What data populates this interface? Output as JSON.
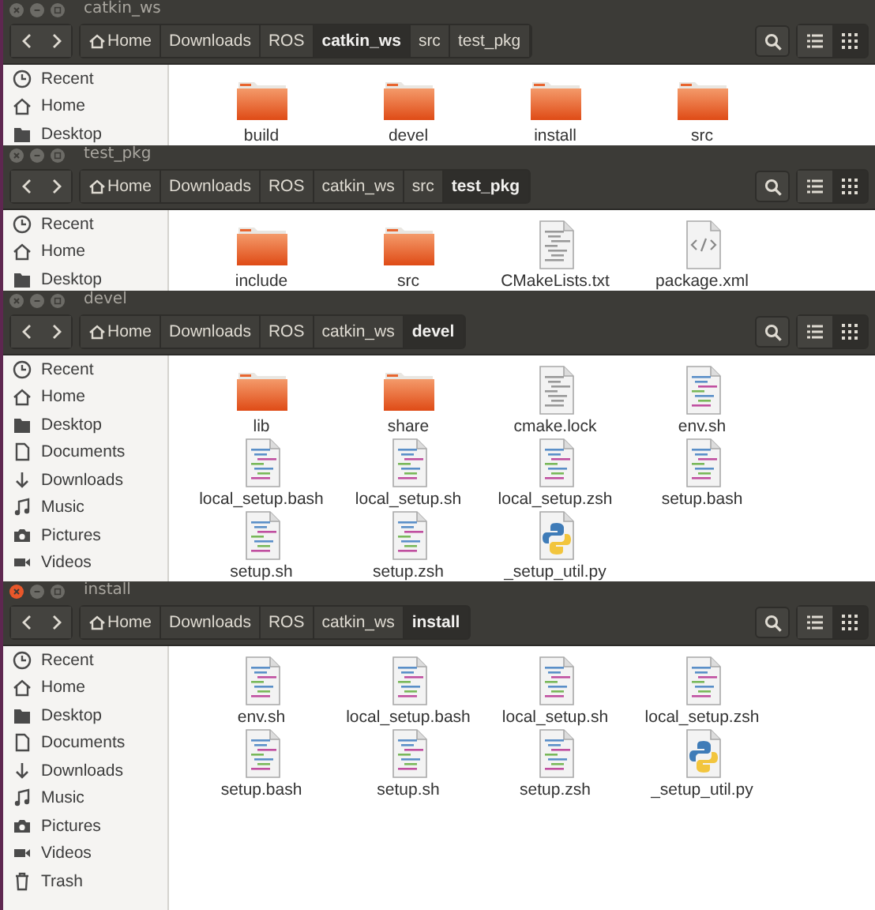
{
  "windows": [
    {
      "title": "catkin_ws",
      "focused": false,
      "path": [
        {
          "label": "Home",
          "kind": "home",
          "selected": false
        },
        {
          "label": "Downloads",
          "kind": "dir",
          "selected": false
        },
        {
          "label": "ROS",
          "kind": "dir",
          "selected": false
        },
        {
          "label": "catkin_ws",
          "kind": "dir",
          "selected": true
        },
        {
          "label": "src",
          "kind": "dir",
          "selected": false
        },
        {
          "label": "test_pkg",
          "kind": "dir",
          "selected": false
        }
      ],
      "views": [
        {
          "kind": "list",
          "selected": false
        },
        {
          "kind": "grid",
          "selected": true
        }
      ],
      "sidebar": [
        {
          "label": "Recent",
          "kind": "recent"
        },
        {
          "label": "Home",
          "kind": "home"
        },
        {
          "label": "Desktop",
          "kind": "desktop"
        }
      ],
      "files": [
        {
          "name": "build",
          "kind": "folder"
        },
        {
          "name": "devel",
          "kind": "folder"
        },
        {
          "name": "install",
          "kind": "folder"
        },
        {
          "name": "src",
          "kind": "folder"
        }
      ]
    },
    {
      "title": "test_pkg",
      "focused": false,
      "path": [
        {
          "label": "Home",
          "kind": "home",
          "selected": false
        },
        {
          "label": "Downloads",
          "kind": "dir",
          "selected": false
        },
        {
          "label": "ROS",
          "kind": "dir",
          "selected": false
        },
        {
          "label": "catkin_ws",
          "kind": "dir",
          "selected": false
        },
        {
          "label": "src",
          "kind": "dir",
          "selected": false
        },
        {
          "label": "test_pkg",
          "kind": "dir",
          "selected": true
        }
      ],
      "views": [
        {
          "kind": "list",
          "selected": false
        },
        {
          "kind": "grid",
          "selected": true
        }
      ],
      "sidebar": [
        {
          "label": "Recent",
          "kind": "recent"
        },
        {
          "label": "Home",
          "kind": "home"
        },
        {
          "label": "Desktop",
          "kind": "desktop"
        }
      ],
      "files": [
        {
          "name": "include",
          "kind": "folder"
        },
        {
          "name": "src",
          "kind": "folder"
        },
        {
          "name": "CMakeLists.txt",
          "kind": "text"
        },
        {
          "name": "package.xml",
          "kind": "xml"
        }
      ]
    },
    {
      "title": "devel",
      "focused": false,
      "path": [
        {
          "label": "Home",
          "kind": "home",
          "selected": false
        },
        {
          "label": "Downloads",
          "kind": "dir",
          "selected": false
        },
        {
          "label": "ROS",
          "kind": "dir",
          "selected": false
        },
        {
          "label": "catkin_ws",
          "kind": "dir",
          "selected": false
        },
        {
          "label": "devel",
          "kind": "dir",
          "selected": true
        }
      ],
      "views": [
        {
          "kind": "list",
          "selected": false
        },
        {
          "kind": "grid",
          "selected": true
        }
      ],
      "sidebar": [
        {
          "label": "Recent",
          "kind": "recent"
        },
        {
          "label": "Home",
          "kind": "home"
        },
        {
          "label": "Desktop",
          "kind": "desktop"
        },
        {
          "label": "Documents",
          "kind": "documents"
        },
        {
          "label": "Downloads",
          "kind": "downloads"
        },
        {
          "label": "Music",
          "kind": "music"
        },
        {
          "label": "Pictures",
          "kind": "pictures"
        },
        {
          "label": "Videos",
          "kind": "videos"
        }
      ],
      "files": [
        {
          "name": "lib",
          "kind": "folder"
        },
        {
          "name": "share",
          "kind": "folder"
        },
        {
          "name": "cmake.lock",
          "kind": "text"
        },
        {
          "name": "env.sh",
          "kind": "script"
        },
        {
          "name": "local_setup.bash",
          "kind": "script"
        },
        {
          "name": "local_setup.sh",
          "kind": "script"
        },
        {
          "name": "local_setup.zsh",
          "kind": "script"
        },
        {
          "name": "setup.bash",
          "kind": "script"
        },
        {
          "name": "setup.sh",
          "kind": "script"
        },
        {
          "name": "setup.zsh",
          "kind": "script"
        },
        {
          "name": "_setup_util.py",
          "kind": "python"
        }
      ]
    },
    {
      "title": "install",
      "focused": true,
      "path": [
        {
          "label": "Home",
          "kind": "home",
          "selected": false
        },
        {
          "label": "Downloads",
          "kind": "dir",
          "selected": false
        },
        {
          "label": "ROS",
          "kind": "dir",
          "selected": false
        },
        {
          "label": "catkin_ws",
          "kind": "dir",
          "selected": false
        },
        {
          "label": "install",
          "kind": "dir",
          "selected": true
        }
      ],
      "views": [
        {
          "kind": "list",
          "selected": false
        },
        {
          "kind": "grid",
          "selected": true
        }
      ],
      "sidebar": [
        {
          "label": "Recent",
          "kind": "recent"
        },
        {
          "label": "Home",
          "kind": "home"
        },
        {
          "label": "Desktop",
          "kind": "desktop"
        },
        {
          "label": "Documents",
          "kind": "documents"
        },
        {
          "label": "Downloads",
          "kind": "downloads"
        },
        {
          "label": "Music",
          "kind": "music"
        },
        {
          "label": "Pictures",
          "kind": "pictures"
        },
        {
          "label": "Videos",
          "kind": "videos"
        },
        {
          "label": "Trash",
          "kind": "trash"
        }
      ],
      "files": [
        {
          "name": "env.sh",
          "kind": "script"
        },
        {
          "name": "local_setup.bash",
          "kind": "script"
        },
        {
          "name": "local_setup.sh",
          "kind": "script"
        },
        {
          "name": "local_setup.zsh",
          "kind": "script"
        },
        {
          "name": "setup.bash",
          "kind": "script"
        },
        {
          "name": "setup.sh",
          "kind": "script"
        },
        {
          "name": "setup.zsh",
          "kind": "script"
        },
        {
          "name": "_setup_util.py",
          "kind": "python"
        }
      ]
    }
  ]
}
